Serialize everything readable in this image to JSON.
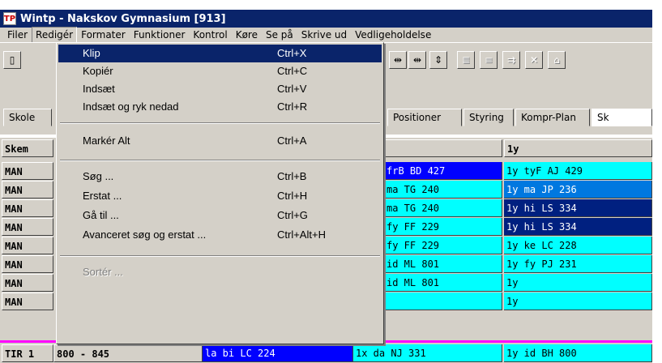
{
  "window": {
    "title": "Wintp - Nakskov Gymnasium [913]",
    "icon_text": "TP"
  },
  "menubar": [
    "Filer",
    "Redigér",
    "Formater",
    "Funktioner",
    "Kontrol",
    "Køre",
    "Se på",
    "Skrive ud",
    "Vedligeholdelse"
  ],
  "edit_menu": [
    {
      "label": "Klip",
      "shortcut": "Ctrl+X"
    },
    {
      "label": "Kopiér",
      "shortcut": "Ctrl+C"
    },
    {
      "label": "Indsæt",
      "shortcut": "Ctrl+V"
    },
    {
      "label": "Indsæt og ryk nedad",
      "shortcut": "Ctrl+R"
    },
    {
      "label": "Markér Alt",
      "shortcut": "Ctrl+A"
    },
    {
      "label": "Søg ...",
      "shortcut": "Ctrl+B"
    },
    {
      "label": "Erstat ...",
      "shortcut": "Ctrl+H"
    },
    {
      "label": "Gå til ...",
      "shortcut": "Ctrl+G"
    },
    {
      "label": "Avanceret søg og erstat ...",
      "shortcut": "Ctrl+Alt+H"
    },
    {
      "label": "Sortér ...",
      "shortcut": ""
    }
  ],
  "tabs": [
    "Skole",
    "Positioner",
    "Styring",
    "Kompr-Plan",
    "Sk"
  ],
  "grid": {
    "corner_header": "Skem",
    "col_header_1y": "1y",
    "row_labels": [
      "MAN",
      "MAN",
      "MAN",
      "MAN",
      "MAN",
      "MAN",
      "MAN",
      "MAN"
    ],
    "col_a": [
      "frB BD 427",
      "ma TG 240",
      "ma TG 240",
      "fy FF 229",
      "fy FF 229",
      "id ML 801",
      "id ML 801",
      ""
    ],
    "col_b": [
      "1y tyF AJ 429",
      "1y ma JP 236",
      "1y hi LS 334",
      "1y hi LS 334",
      "1y ke LC 228",
      "1y fy PJ 231",
      "1y",
      "1y"
    ],
    "last_row": {
      "day": "TIR 1",
      "time": "800 -  845",
      "c1": "la bi LC 224",
      "c2": "1x da NJ 331",
      "c3": "1y id BH 800"
    }
  }
}
